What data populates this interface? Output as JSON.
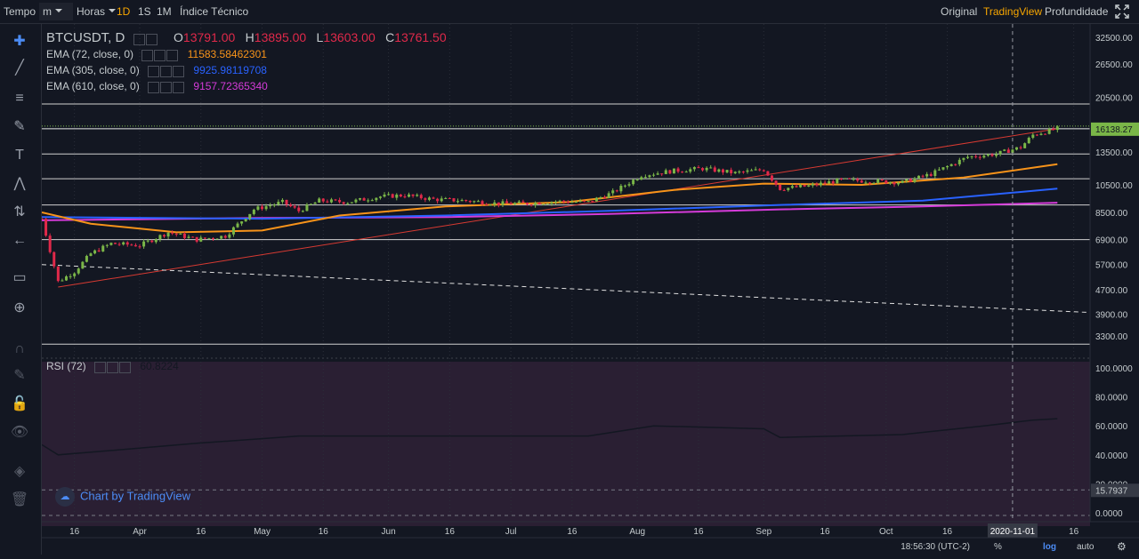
{
  "toolbar": {
    "tempo": "Tempo",
    "unit_value": "m",
    "horas": "Horas",
    "intervals": [
      "1D",
      "1S",
      "1M"
    ],
    "active_interval": "1D",
    "indicators": "Índice Técnico",
    "views": [
      "Original",
      "TradingView",
      "Profundidade"
    ],
    "active_view": "TradingView"
  },
  "legend": {
    "symbol": "BTCUSDT, D",
    "open_label": "O",
    "open": "13791.00",
    "high_label": "H",
    "high": "13895.00",
    "low_label": "L",
    "low": "13603.00",
    "close_label": "C",
    "close": "13761.50",
    "ema72_label": "EMA (72, close, 0)",
    "ema72_value": "11583.58462301",
    "ema305_label": "EMA (305, close, 0)",
    "ema305_value": "9925.98119708",
    "ema610_label": "EMA (610, close, 0)",
    "ema610_value": "9157.72365340",
    "rsi_label": "RSI (72)",
    "rsi_value": "60.8224"
  },
  "colors": {
    "bg": "#131722",
    "up": "#7ab648",
    "down": "#e0294a",
    "ema72": "#f7931a",
    "ema305": "#2962ff",
    "ema610": "#d53bd9",
    "trend": "#d83a32",
    "rsi_bg": "#2a1f33"
  },
  "price_scale": {
    "ticks": [
      "32500.00",
      "26500.00",
      "20500.00",
      "16138.27",
      "13500.00",
      "10500.00",
      "8500.00",
      "6900.00",
      "5700.00",
      "4700.00",
      "3900.00",
      "3300.00"
    ],
    "last_price": "16138.27"
  },
  "rsi_scale": {
    "ticks": [
      "100.0000",
      "80.0000",
      "60.0000",
      "40.0000",
      "20.0000",
      "15.7937",
      "0.0000"
    ],
    "last_value": "15.7937"
  },
  "time_scale": {
    "labels": [
      "16",
      "Apr",
      "16",
      "May",
      "16",
      "Jun",
      "16",
      "Jul",
      "16",
      "Aug",
      "16",
      "Sep",
      "16",
      "Oct",
      "16",
      "2020-11-01",
      "16"
    ],
    "crosshair_label": "2020-11-01"
  },
  "bottom": {
    "time": "18:56:30 (UTC-2)",
    "percent": "%",
    "log": "log",
    "auto": "auto"
  },
  "watermark": "Chart by TradingView",
  "tools": [
    "crosshair-icon",
    "trend-line-icon",
    "fib-icon",
    "brush-icon",
    "text-icon",
    "pattern-icon",
    "prediction-icon",
    "back-icon",
    "ruler-icon",
    "zoom-icon",
    "magnet-icon",
    "lock-draw-icon",
    "lock-icon",
    "eye-icon",
    "layers-icon",
    "trash-icon"
  ],
  "chart_data": {
    "type": "candlestick",
    "title": "BTCUSDT, D",
    "x_range": [
      "2020-03-08",
      "2020-11-20"
    ],
    "y_scale": "log",
    "y_range": [
      2900,
      36000
    ],
    "close_series": [
      [
        "2020-03-08",
        8100
      ],
      [
        "2020-03-12",
        5000
      ],
      [
        "2020-03-16",
        5400
      ],
      [
        "2020-03-20",
        6200
      ],
      [
        "2020-03-25",
        6700
      ],
      [
        "2020-04-01",
        6600
      ],
      [
        "2020-04-08",
        7300
      ],
      [
        "2020-04-15",
        6900
      ],
      [
        "2020-04-22",
        7100
      ],
      [
        "2020-04-29",
        8700
      ],
      [
        "2020-05-06",
        9200
      ],
      [
        "2020-05-10",
        8600
      ],
      [
        "2020-05-15",
        9300
      ],
      [
        "2020-05-22",
        9200
      ],
      [
        "2020-05-30",
        9600
      ],
      [
        "2020-06-05",
        9700
      ],
      [
        "2020-06-12",
        9400
      ],
      [
        "2020-06-20",
        9300
      ],
      [
        "2020-06-28",
        9100
      ],
      [
        "2020-07-05",
        9100
      ],
      [
        "2020-07-12",
        9250
      ],
      [
        "2020-07-20",
        9200
      ],
      [
        "2020-07-26",
        9900
      ],
      [
        "2020-08-02",
        11300
      ],
      [
        "2020-08-10",
        11700
      ],
      [
        "2020-08-17",
        11900
      ],
      [
        "2020-08-25",
        11500
      ],
      [
        "2020-09-01",
        11800
      ],
      [
        "2020-09-05",
        10200
      ],
      [
        "2020-09-12",
        10400
      ],
      [
        "2020-09-20",
        10900
      ],
      [
        "2020-09-28",
        10800
      ],
      [
        "2020-10-05",
        10700
      ],
      [
        "2020-10-12",
        11400
      ],
      [
        "2020-10-21",
        13000
      ],
      [
        "2020-10-28",
        13300
      ],
      [
        "2020-11-03",
        14000
      ],
      [
        "2020-11-06",
        15400
      ],
      [
        "2020-11-12",
        16138
      ]
    ],
    "ema72": [
      [
        "2020-03-08",
        8500
      ],
      [
        "2020-03-20",
        7800
      ],
      [
        "2020-04-10",
        7300
      ],
      [
        "2020-05-01",
        7400
      ],
      [
        "2020-05-20",
        8300
      ],
      [
        "2020-06-15",
        8900
      ],
      [
        "2020-07-15",
        9200
      ],
      [
        "2020-08-10",
        10100
      ],
      [
        "2020-09-01",
        10600
      ],
      [
        "2020-09-25",
        10500
      ],
      [
        "2020-10-20",
        11100
      ],
      [
        "2020-11-12",
        12300
      ]
    ],
    "ema305": [
      [
        "2020-03-08",
        8200
      ],
      [
        "2020-05-01",
        8100
      ],
      [
        "2020-06-15",
        8300
      ],
      [
        "2020-07-25",
        8600
      ],
      [
        "2020-09-05",
        9000
      ],
      [
        "2020-10-10",
        9300
      ],
      [
        "2020-11-12",
        10200
      ]
    ],
    "ema610": [
      [
        "2020-03-08",
        8000
      ],
      [
        "2020-05-01",
        8150
      ],
      [
        "2020-06-15",
        8200
      ],
      [
        "2020-07-25",
        8400
      ],
      [
        "2020-09-05",
        8700
      ],
      [
        "2020-10-10",
        8900
      ],
      [
        "2020-11-12",
        9160
      ]
    ],
    "trend_support": [
      [
        "2020-03-12",
        4800
      ],
      [
        "2020-11-12",
        16138
      ]
    ],
    "trend_dashed": [
      [
        "2020-03-08",
        5700
      ],
      [
        "2020-11-20",
        3950
      ]
    ],
    "horizontal_levels": [
      19500,
      16138,
      13300,
      11000,
      9000,
      6900,
      3100
    ],
    "rsi": [
      [
        "2020-03-08",
        47
      ],
      [
        "2020-03-12",
        40
      ],
      [
        "2020-03-25",
        43
      ],
      [
        "2020-04-15",
        48
      ],
      [
        "2020-05-10",
        53
      ],
      [
        "2020-06-10",
        53
      ],
      [
        "2020-07-20",
        53
      ],
      [
        "2020-08-05",
        60
      ],
      [
        "2020-09-01",
        58
      ],
      [
        "2020-09-05",
        52
      ],
      [
        "2020-10-05",
        54
      ],
      [
        "2020-10-25",
        60
      ],
      [
        "2020-11-06",
        64
      ],
      [
        "2020-11-12",
        65
      ]
    ]
  }
}
